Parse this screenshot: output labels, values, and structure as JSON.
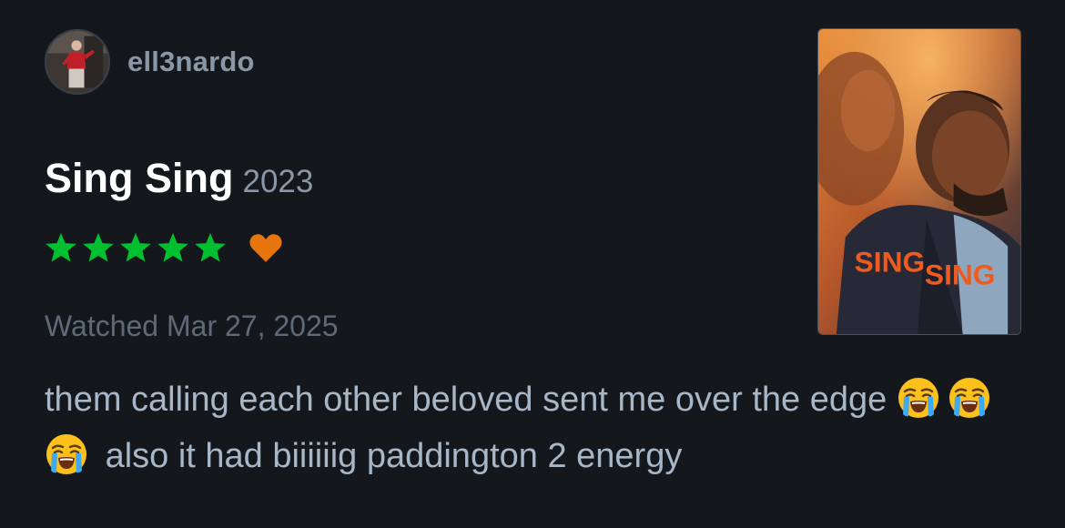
{
  "user": {
    "username": "ell3nardo",
    "avatar": "profile-photo"
  },
  "film": {
    "title": "Sing Sing",
    "year": "2023",
    "poster": {
      "word1": "SING",
      "word2": "SING"
    }
  },
  "rating": {
    "stars": 5,
    "max_stars": 5,
    "liked": true,
    "star_color": "#00c030",
    "heart_color": "#e5750c"
  },
  "watched": "Watched Mar 27, 2025",
  "review": {
    "part1": "them calling each other beloved sent me over the edge",
    "emoji": "loudly-crying-face",
    "emoji_count": 3,
    "part2": "also it had biiiiiig paddington 2 energy"
  }
}
